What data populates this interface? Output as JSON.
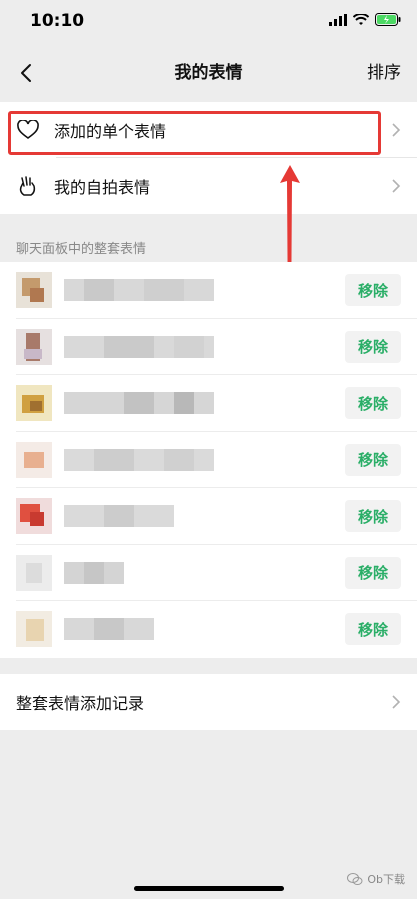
{
  "status": {
    "time": "10:10"
  },
  "nav": {
    "title": "我的表情",
    "action": "排序"
  },
  "top_rows": [
    {
      "label": "添加的单个表情",
      "icon": "heart-icon"
    },
    {
      "label": "我的自拍表情",
      "icon": "hand-icon"
    }
  ],
  "section": {
    "title": "聊天面板中的整套表情"
  },
  "sets": [
    {
      "remove_label": "移除"
    },
    {
      "remove_label": "移除"
    },
    {
      "remove_label": "移除"
    },
    {
      "remove_label": "移除"
    },
    {
      "remove_label": "移除"
    },
    {
      "remove_label": "移除"
    },
    {
      "remove_label": "移除"
    }
  ],
  "record": {
    "label": "整套表情添加记录"
  },
  "watermark": {
    "text": "Ob下载"
  },
  "colors": {
    "accent": "#2aae67",
    "highlight": "#e53935"
  }
}
